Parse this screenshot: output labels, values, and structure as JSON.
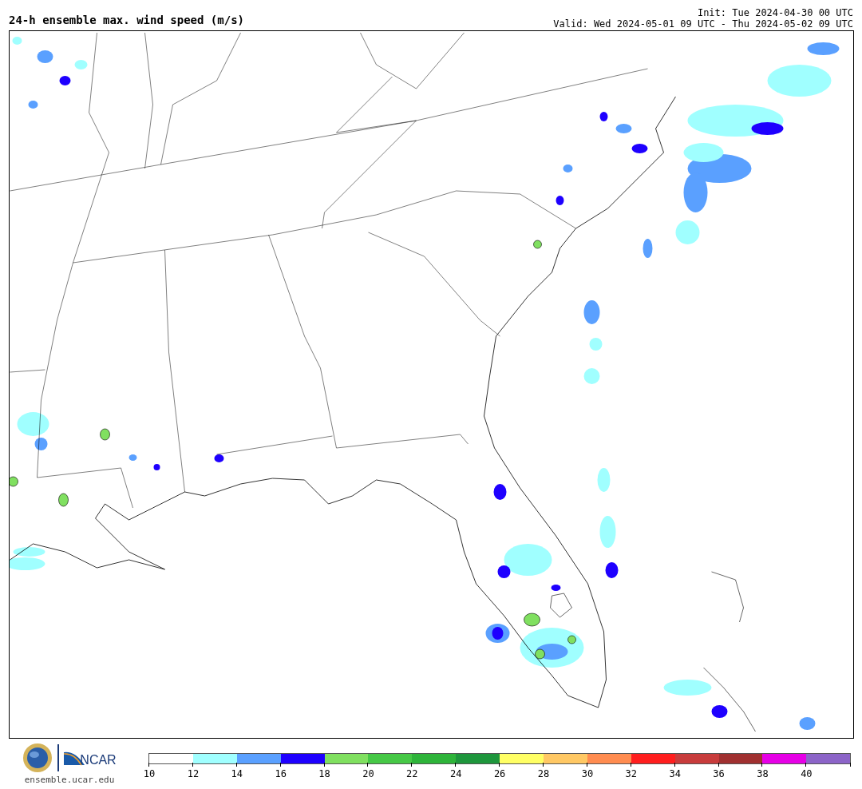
{
  "title": "24-h ensemble max. wind speed (m/s)",
  "init": "Init: Tue 2024-04-30 00 UTC",
  "valid": "Valid: Wed 2024-05-01 09 UTC - Thu 2024-05-02 09 UTC",
  "logo": {
    "org": "NCAR",
    "site": "ensemble.ucar.edu"
  },
  "legend": [
    {
      "label": "10",
      "color": "#ffffff"
    },
    {
      "label": "12",
      "color": "#a0ffff"
    },
    {
      "label": "14",
      "color": "#5aa0ff"
    },
    {
      "label": "16",
      "color": "#1e00ff"
    },
    {
      "label": "18",
      "color": "#80e060"
    },
    {
      "label": "20",
      "color": "#46c846"
    },
    {
      "label": "22",
      "color": "#2eb43a"
    },
    {
      "label": "24",
      "color": "#1e963c"
    },
    {
      "label": "26",
      "color": "#ffff64"
    },
    {
      "label": "28",
      "color": "#ffc864"
    },
    {
      "label": "30",
      "color": "#ff8c50"
    },
    {
      "label": "32",
      "color": "#ff1e1e"
    },
    {
      "label": "34",
      "color": "#c83c3c"
    },
    {
      "label": "36",
      "color": "#a03030"
    },
    {
      "label": "38",
      "color": "#e600e6"
    },
    {
      "label": "40",
      "color": "#8c64c8"
    }
  ]
}
